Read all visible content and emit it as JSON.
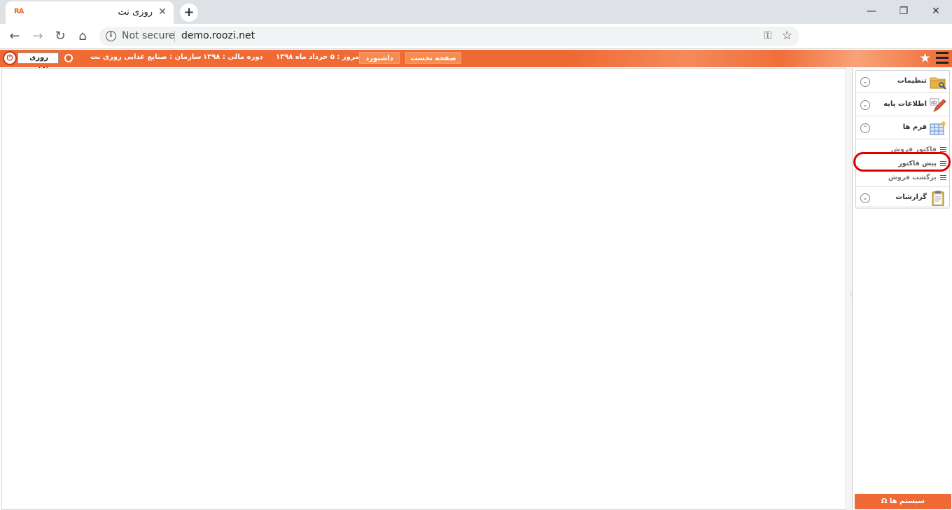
{
  "browser": {
    "tab_title": "روزی نت",
    "favicon_text": "RA",
    "tab_close": "✕",
    "new_tab": "+",
    "security_label": "Not secure",
    "url": "demo.roozi.net",
    "window_controls": {
      "minimize": "—",
      "maximize": "❐",
      "close": "✕"
    }
  },
  "appbar": {
    "home_button": "صفحه نخست",
    "dashboard_button": "داشبورد",
    "today": "امروز : ۵ خرداد ماه ۱۳۹۸",
    "fiscal_period": "دوره مالی : ۱۳۹۸",
    "organization": "سازمان : صنایع غذایی روزی نت",
    "user_name": "روزی نت"
  },
  "sidebar": {
    "sections": [
      {
        "label": "تنظیمات",
        "toggle": "⌄"
      },
      {
        "label": "اطلاعات پایه",
        "toggle": "⌄"
      },
      {
        "label": "فرم ها",
        "toggle": "⌃"
      },
      {
        "label": "گزارشات",
        "toggle": "⌄"
      }
    ],
    "form_items": [
      {
        "label": "فاکتور فروش"
      },
      {
        "label": "پیش فاکتور"
      },
      {
        "label": "برگشت فروش"
      }
    ],
    "systems_button": "سیستم ها Ω"
  },
  "colors": {
    "brand_orange": "#ef6a35",
    "highlight_red": "#e00000"
  }
}
